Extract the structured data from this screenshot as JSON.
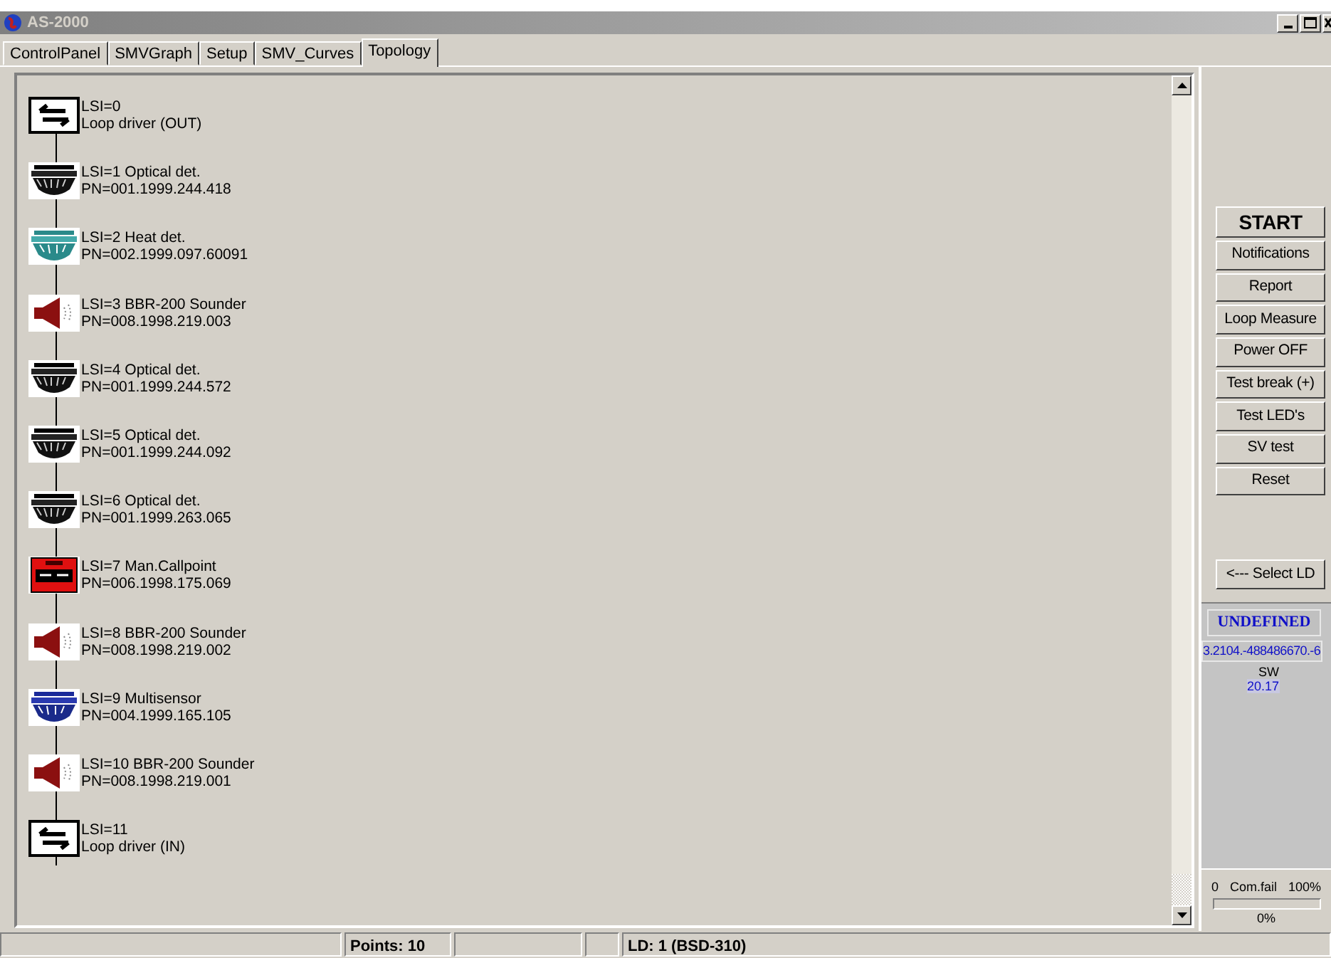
{
  "window": {
    "title": "AS-2000"
  },
  "tabs": [
    {
      "label": "ControlPanel",
      "selected": false
    },
    {
      "label": "SMVGraph",
      "selected": false
    },
    {
      "label": "Setup",
      "selected": false
    },
    {
      "label": "SMV_Curves",
      "selected": false
    },
    {
      "label": "Topology",
      "selected": true
    }
  ],
  "devices": [
    {
      "kind": "loopdriver",
      "line_1": "LSI=0",
      "line_2": "Loop driver (OUT)"
    },
    {
      "kind": "optical",
      "line_1": "LSI=1 Optical det.",
      "line_2": "PN=001.1999.244.418"
    },
    {
      "kind": "heat",
      "line_1": "LSI=2 Heat det.",
      "line_2": "PN=002.1999.097.60091"
    },
    {
      "kind": "sounder",
      "line_1": "LSI=3 BBR-200 Sounder",
      "line_2": "PN=008.1998.219.003"
    },
    {
      "kind": "optical",
      "line_1": "LSI=4 Optical det.",
      "line_2": "PN=001.1999.244.572"
    },
    {
      "kind": "optical",
      "line_1": "LSI=5 Optical det.",
      "line_2": "PN=001.1999.244.092"
    },
    {
      "kind": "optical",
      "line_1": "LSI=6 Optical det.",
      "line_2": "PN=001.1999.263.065"
    },
    {
      "kind": "callpoint",
      "line_1": "LSI=7 Man.Callpoint",
      "line_2": "PN=006.1998.175.069"
    },
    {
      "kind": "sounder",
      "line_1": "LSI=8 BBR-200 Sounder",
      "line_2": "PN=008.1998.219.002"
    },
    {
      "kind": "multisensor",
      "line_1": "LSI=9 Multisensor",
      "line_2": "PN=004.1999.165.105"
    },
    {
      "kind": "sounder",
      "line_1": "LSI=10 BBR-200 Sounder",
      "line_2": "PN=008.1998.219.001"
    },
    {
      "kind": "loopdriver",
      "line_1": "LSI=11",
      "line_2": "Loop driver (IN)"
    }
  ],
  "buttons": [
    "START",
    "Notifications",
    "Report",
    "Loop Measure",
    "Power OFF",
    "Test break (+)",
    "Test LED's",
    "SV test",
    "Reset"
  ],
  "select_button": "<--- Select LD",
  "info": {
    "status": "UNDEFINED",
    "id": "3.2104.-488486670.-6",
    "sw_label": "SW",
    "sw_value": "20.17"
  },
  "comfail": {
    "min_label": "0",
    "label": "Com.fail",
    "max_label": "100%",
    "level": 0,
    "reading": "0%"
  },
  "status_bar": {
    "points": "Points: 10",
    "loop_driver": "LD: 1 (BSD-310)"
  }
}
